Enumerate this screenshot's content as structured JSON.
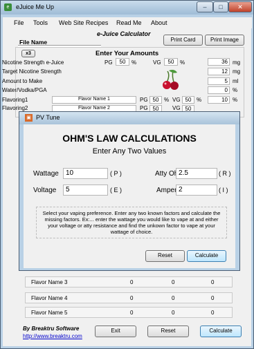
{
  "window": {
    "title": "eJuice Me Up",
    "icon_label": "e"
  },
  "window_controls": [
    "–",
    "□",
    "✕"
  ],
  "menu": [
    "File",
    "Tools",
    "Web Site Recipes",
    "Read Me",
    "About"
  ],
  "toolbar": {
    "file_name_label": "File Name",
    "calc_title": "e-Juice Calculator",
    "print_card": "Print Card",
    "print_image": "Print Image"
  },
  "amounts": {
    "multiplier": "x3",
    "heading": "Enter Your Amounts",
    "nicotine_label": "Nicotine Strength e-Juice",
    "pg_label": "PG",
    "pg_value": "50",
    "pct": "%",
    "vg_label": "VG",
    "vg_value": "50",
    "nicotine_value": "36",
    "mg": "mg",
    "target_label": "Target Nicotine Strength",
    "target_value": "12",
    "amount_label": "Amount to Make",
    "amount_value": "5",
    "ml": "ml",
    "water_label": "Water/Vodka/PGA",
    "water_value": "0",
    "flavoring1_label": "Flavoring1",
    "flavor1_name": "Flavor Name 1",
    "f1_pg": "50",
    "f1_vg": "50",
    "f1_value": "10",
    "flavoring2_label": "Flavoring2",
    "flavor2_name": "Flavor Name 2",
    "f2_pg": "50",
    "f2_vg": "50"
  },
  "flavor_rows": [
    {
      "name": "Flavor Name 3",
      "a": "0",
      "b": "0",
      "c": "0"
    },
    {
      "name": "Flavor Name 4",
      "a": "0",
      "b": "0",
      "c": "0"
    },
    {
      "name": "Flavor Name 5",
      "a": "0",
      "b": "0",
      "c": "0"
    }
  ],
  "footer": {
    "by": "By Breaktru Software",
    "link": "http://www.breaktru.com",
    "exit": "Exit",
    "reset": "Reset",
    "calculate": "Calculate"
  },
  "dialog": {
    "title": "PV Tune",
    "title_icon": "▣",
    "heading": "OHM'S LAW CALCULATIONS",
    "subheading": "Enter Any Two Values",
    "wattage_label": "Wattage",
    "wattage_value": "10",
    "wattage_unit": "( P )",
    "ohms_label": "Atty Ohms",
    "ohms_value": "2.5",
    "ohms_unit": "( R )",
    "voltage_label": "Voltage",
    "voltage_value": "5",
    "voltage_unit": "( E )",
    "amperage_label": "Amperage",
    "amperage_value": "2",
    "amperage_unit": "( I )",
    "instructions": "Select your vaping preference. Enter any two known factors and calculate the missing factors. Ex:... enter the wattage you would like to vape at and either your voltage or atty resistance and find the unkown factor to vape at your wattage of choice.",
    "reset": "Reset",
    "calculate": "Calculate"
  },
  "colors": {
    "frame": "#b9d1e6",
    "client": "#f0f0f0",
    "accent": "#3c7fb1",
    "cherry": "#c8102e"
  }
}
